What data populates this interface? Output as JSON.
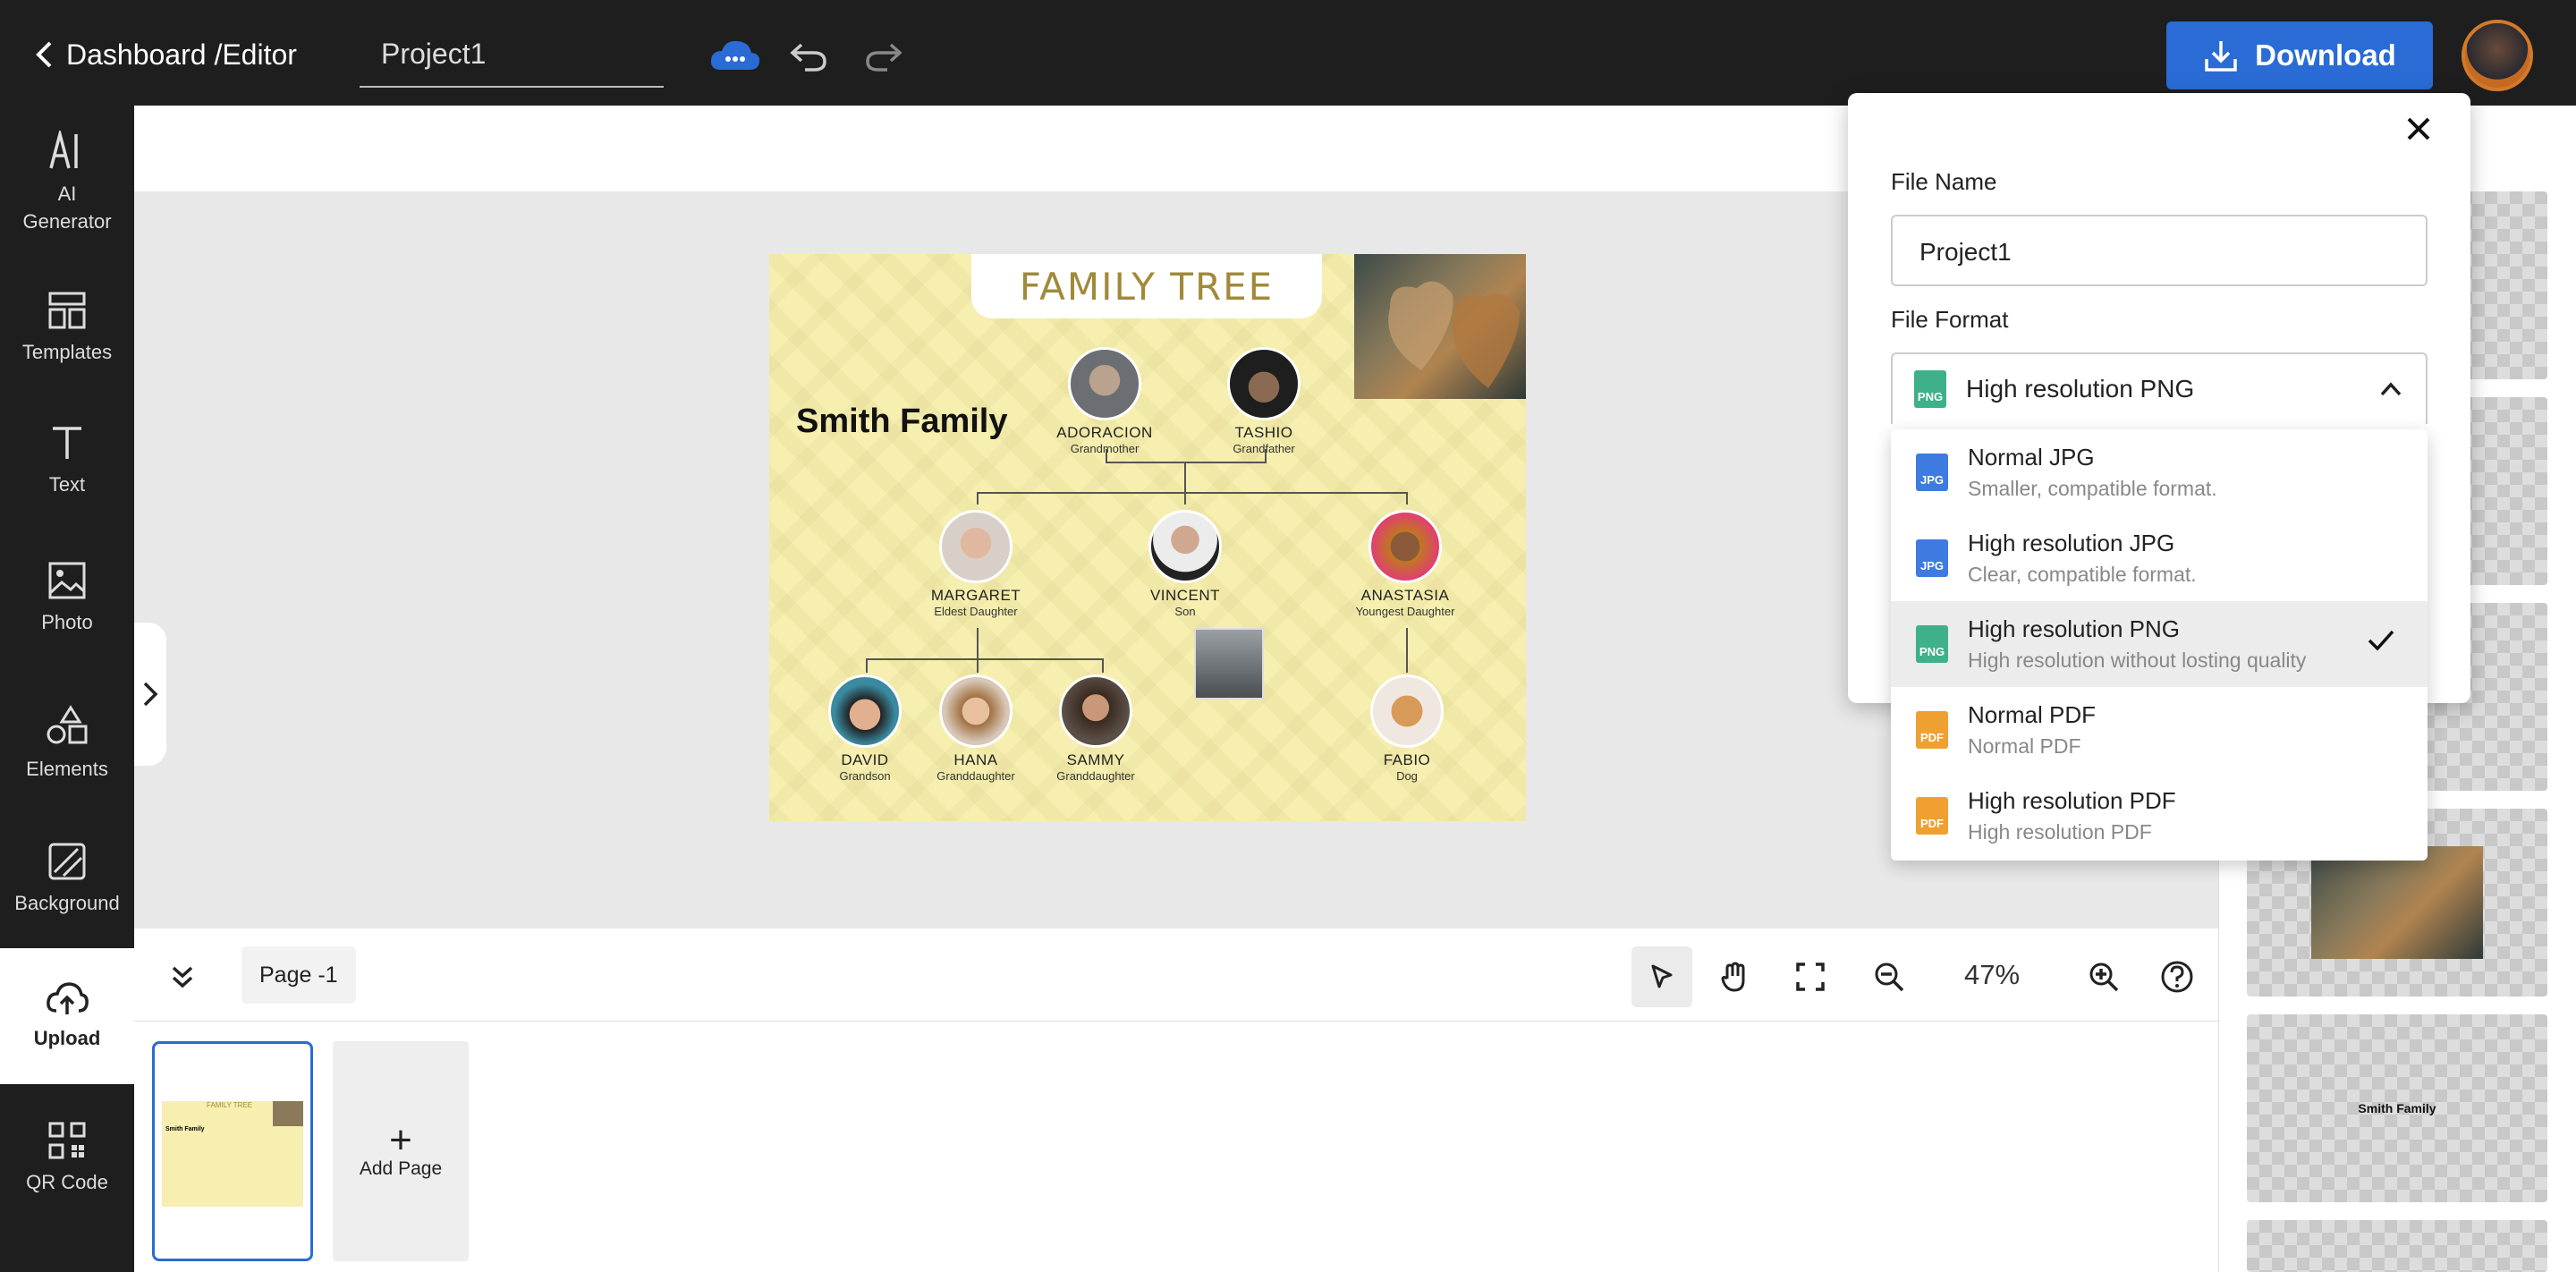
{
  "header": {
    "breadcrumb": "Dashboard /Editor",
    "project_name": "Project1",
    "download_label": "Download"
  },
  "sidebar": {
    "items": [
      {
        "label": "AI\nGenerator"
      },
      {
        "label": "Templates"
      },
      {
        "label": "Text"
      },
      {
        "label": "Photo"
      },
      {
        "label": "Elements"
      },
      {
        "label": "Background"
      },
      {
        "label": "Upload"
      },
      {
        "label": "QR Code"
      }
    ]
  },
  "canvas": {
    "title": "FAMILY TREE",
    "family": "Smith Family",
    "people": [
      {
        "name": "ADORACION",
        "role": "Grandmother"
      },
      {
        "name": "TASHIO",
        "role": "Grandfather"
      },
      {
        "name": "MARGARET",
        "role": "Eldest Daughter"
      },
      {
        "name": "VINCENT",
        "role": "Son"
      },
      {
        "name": "ANASTASIA",
        "role": "Youngest Daughter"
      },
      {
        "name": "DAVID",
        "role": "Grandson"
      },
      {
        "name": "HANA",
        "role": "Granddaughter"
      },
      {
        "name": "SAMMY",
        "role": "Granddaughter"
      },
      {
        "name": "FABIO",
        "role": "Dog"
      }
    ]
  },
  "bottom": {
    "page_label": "Page -1",
    "zoom": "47%",
    "add_page": "Add Page",
    "thumb_title": "FAMILY TREE",
    "thumb_family": "Smith Family"
  },
  "right_panel": {
    "thumb_text": "Smith Family"
  },
  "download_dialog": {
    "file_name_label": "File Name",
    "file_name_value": "Project1",
    "file_format_label": "File Format",
    "selected_format": "High resolution PNG",
    "options": [
      {
        "title": "Normal JPG",
        "desc": "Smaller, compatible format.",
        "type": "JPG"
      },
      {
        "title": "High resolution JPG",
        "desc": "Clear, compatible format.",
        "type": "JPG"
      },
      {
        "title": "High resolution PNG",
        "desc": "High resolution without losting quality",
        "type": "PNG",
        "selected": true
      },
      {
        "title": "Normal PDF",
        "desc": "Normal PDF",
        "type": "PDF"
      },
      {
        "title": "High resolution PDF",
        "desc": "High resolution PDF",
        "type": "PDF"
      }
    ]
  },
  "colors": {
    "accent": "#2a6bd6",
    "jpg": "#3d7be0",
    "png": "#3eb08a",
    "pdf": "#f0a030"
  }
}
